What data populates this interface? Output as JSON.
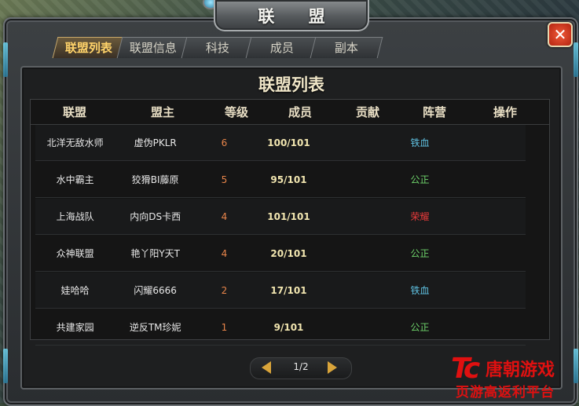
{
  "window": {
    "title": "联 盟",
    "close_label": "✕"
  },
  "tabs": [
    {
      "label": "联盟列表",
      "active": true
    },
    {
      "label": "联盟信息",
      "active": false
    },
    {
      "label": "科技",
      "active": false
    },
    {
      "label": "成员",
      "active": false
    },
    {
      "label": "副本",
      "active": false
    }
  ],
  "panel": {
    "title": "联盟列表"
  },
  "table": {
    "headers": [
      "联盟",
      "盟主",
      "等级",
      "成员",
      "贡献",
      "阵营",
      "操作"
    ],
    "rows": [
      {
        "name": "北洋无敌水师",
        "leader": "虚伪PKLR",
        "level": "6",
        "members": "100/101",
        "contribution": "",
        "faction": "铁血",
        "faction_color": "#5fc0e0",
        "action": ""
      },
      {
        "name": "水中霸主",
        "leader": "狡猾BI藤原",
        "level": "5",
        "members": "95/101",
        "contribution": "",
        "faction": "公正",
        "faction_color": "#6ed36a",
        "action": ""
      },
      {
        "name": "上海战队",
        "leader": "内向DS卡西",
        "level": "4",
        "members": "101/101",
        "contribution": "",
        "faction": "荣耀",
        "faction_color": "#e83a3a",
        "action": ""
      },
      {
        "name": "众神联盟",
        "leader": "艳丫阳Y天T",
        "level": "4",
        "members": "20/101",
        "contribution": "",
        "faction": "公正",
        "faction_color": "#6ed36a",
        "action": ""
      },
      {
        "name": "娃哈哈",
        "leader": "闪耀6666",
        "level": "2",
        "members": "17/101",
        "contribution": "",
        "faction": "铁血",
        "faction_color": "#5fc0e0",
        "action": ""
      },
      {
        "name": "共建家园",
        "leader": "逆反TM珍妮",
        "level": "1",
        "members": "9/101",
        "contribution": "",
        "faction": "公正",
        "faction_color": "#6ed36a",
        "action": ""
      }
    ]
  },
  "pager": {
    "page": "1/2"
  },
  "watermark": {
    "logo": "Tc",
    "name": "唐朝游戏",
    "slogan": "页游高返利平台"
  },
  "colors": {
    "level": "#e8854a",
    "members": "#f2e6b0",
    "tab_active": "#ffd36a"
  }
}
